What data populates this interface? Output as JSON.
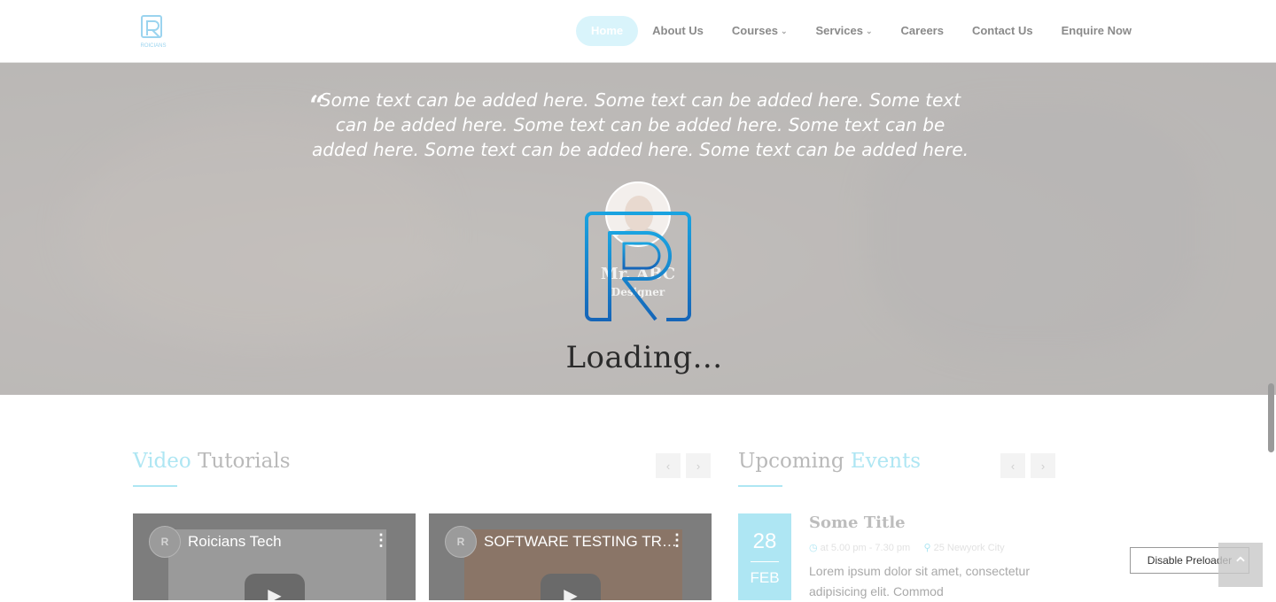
{
  "header": {
    "logo_text": "ROICIANS",
    "nav": [
      {
        "label": "Home",
        "active": true,
        "dropdown": false
      },
      {
        "label": "About Us",
        "active": false,
        "dropdown": false
      },
      {
        "label": "Courses",
        "active": false,
        "dropdown": true
      },
      {
        "label": "Services",
        "active": false,
        "dropdown": true
      },
      {
        "label": "Careers",
        "active": false,
        "dropdown": false
      },
      {
        "label": "Contact Us",
        "active": false,
        "dropdown": false
      },
      {
        "label": "Enquire Now",
        "active": false,
        "dropdown": false
      }
    ]
  },
  "testimonial": {
    "quote": "Some text can be added here. Some text can be added here. Some text can be added here. Some text can be added here. Some text can be added here. Some text can be added here. Some text can be added here.",
    "name": "Mr. ABC",
    "role": "Designer"
  },
  "preloader": {
    "loading_text": "Loading...",
    "disable_label": "Disable Preloader"
  },
  "video_section": {
    "title_accent": "Video",
    "title_rest": "Tutorials",
    "videos": [
      {
        "title": "Roicians Tech"
      },
      {
        "title": "SOFTWARE TESTING TRAINING"
      }
    ]
  },
  "events_section": {
    "title_plain": "Upcoming",
    "title_accent": "Events",
    "event": {
      "day": "28",
      "month": "FEB",
      "title": "Some Title",
      "time": "at 5.00 pm - 7.30 pm",
      "location": "25 Newyork City",
      "description": "Lorem ipsum dolor sit amet, consectetur adipisicing elit. Commod"
    }
  },
  "colors": {
    "accent": "#aee6f3",
    "brand_blue": "#1e88d6"
  }
}
